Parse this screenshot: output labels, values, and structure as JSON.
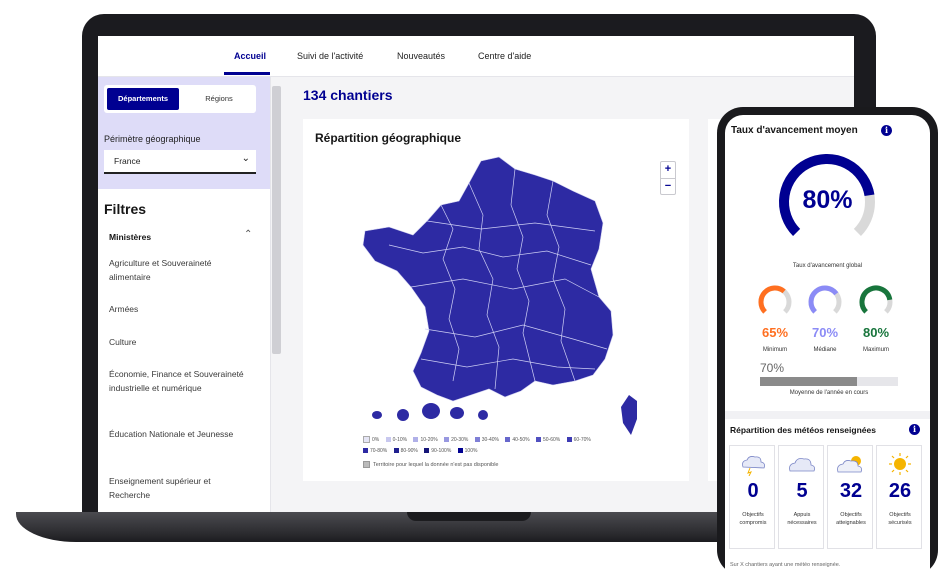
{
  "nav": {
    "tabs": [
      "Accueil",
      "Suivi de l'activité",
      "Nouveautés",
      "Centre d'aide"
    ]
  },
  "sidebar": {
    "scope_toggle": {
      "active": "Départements",
      "inactive": "Régions"
    },
    "perimetre_label": "Périmètre géographique",
    "perimetre_value": "France",
    "filters_title": "Filtres",
    "ministeres_title": "Ministères",
    "ministeres": [
      "Agriculture et Souveraineté alimentaire",
      "Armées",
      "Culture",
      "Économie, Finance et Souveraineté industrielle et numérique",
      "Éducation Nationale et Jeunesse",
      "Enseignement supérieur et Recherche"
    ]
  },
  "main": {
    "count_title": "134 chantiers",
    "map_card": {
      "title": "Répartition géographique",
      "zoom_in": "+",
      "zoom_out": "−",
      "legend": [
        "0%",
        "0-10%",
        "10-20%",
        "20-30%",
        "30-40%",
        "40-50%",
        "50-60%",
        "60-70%",
        "70-80%",
        "80-90%",
        "90-100%",
        "100%"
      ],
      "legend_note": "Territoire pour lequel la donnée n'est pas disponible"
    }
  },
  "phone": {
    "title": "Taux d'avancement moyen",
    "global_value": "80%",
    "global_progress": 0.8,
    "global_label": "Taux d'avancement global",
    "gauges": [
      {
        "value": "65%",
        "progress": 0.65,
        "label": "Minimum",
        "color": "#ff6f20"
      },
      {
        "value": "70%",
        "progress": 0.7,
        "label": "Médiane",
        "color": "#8b8bf6"
      },
      {
        "value": "80%",
        "progress": 0.8,
        "label": "Maximum",
        "color": "#18753c"
      }
    ],
    "year_average_value": "70%",
    "year_average_progress": 0.7,
    "year_average_label": "Moyenne de l'année en cours",
    "meteo_title": "Répartition des météos renseignées",
    "meteos": [
      {
        "value": "0",
        "label": "Objectifs compromis",
        "icon": "storm-cloud-icon"
      },
      {
        "value": "5",
        "label": "Appuis nécessaires",
        "icon": "cloud-icon"
      },
      {
        "value": "32",
        "label": "Objectifs atteignables",
        "icon": "sun-cloud-icon"
      },
      {
        "value": "26",
        "label": "Objectifs sécurisés",
        "icon": "sun-icon"
      }
    ],
    "footer": "Sur X chantiers ayant une météo renseignée."
  },
  "colors": {
    "accent": "#000091",
    "map_fill": "#2d2aa3",
    "panel_bg": "#dedcf8"
  }
}
